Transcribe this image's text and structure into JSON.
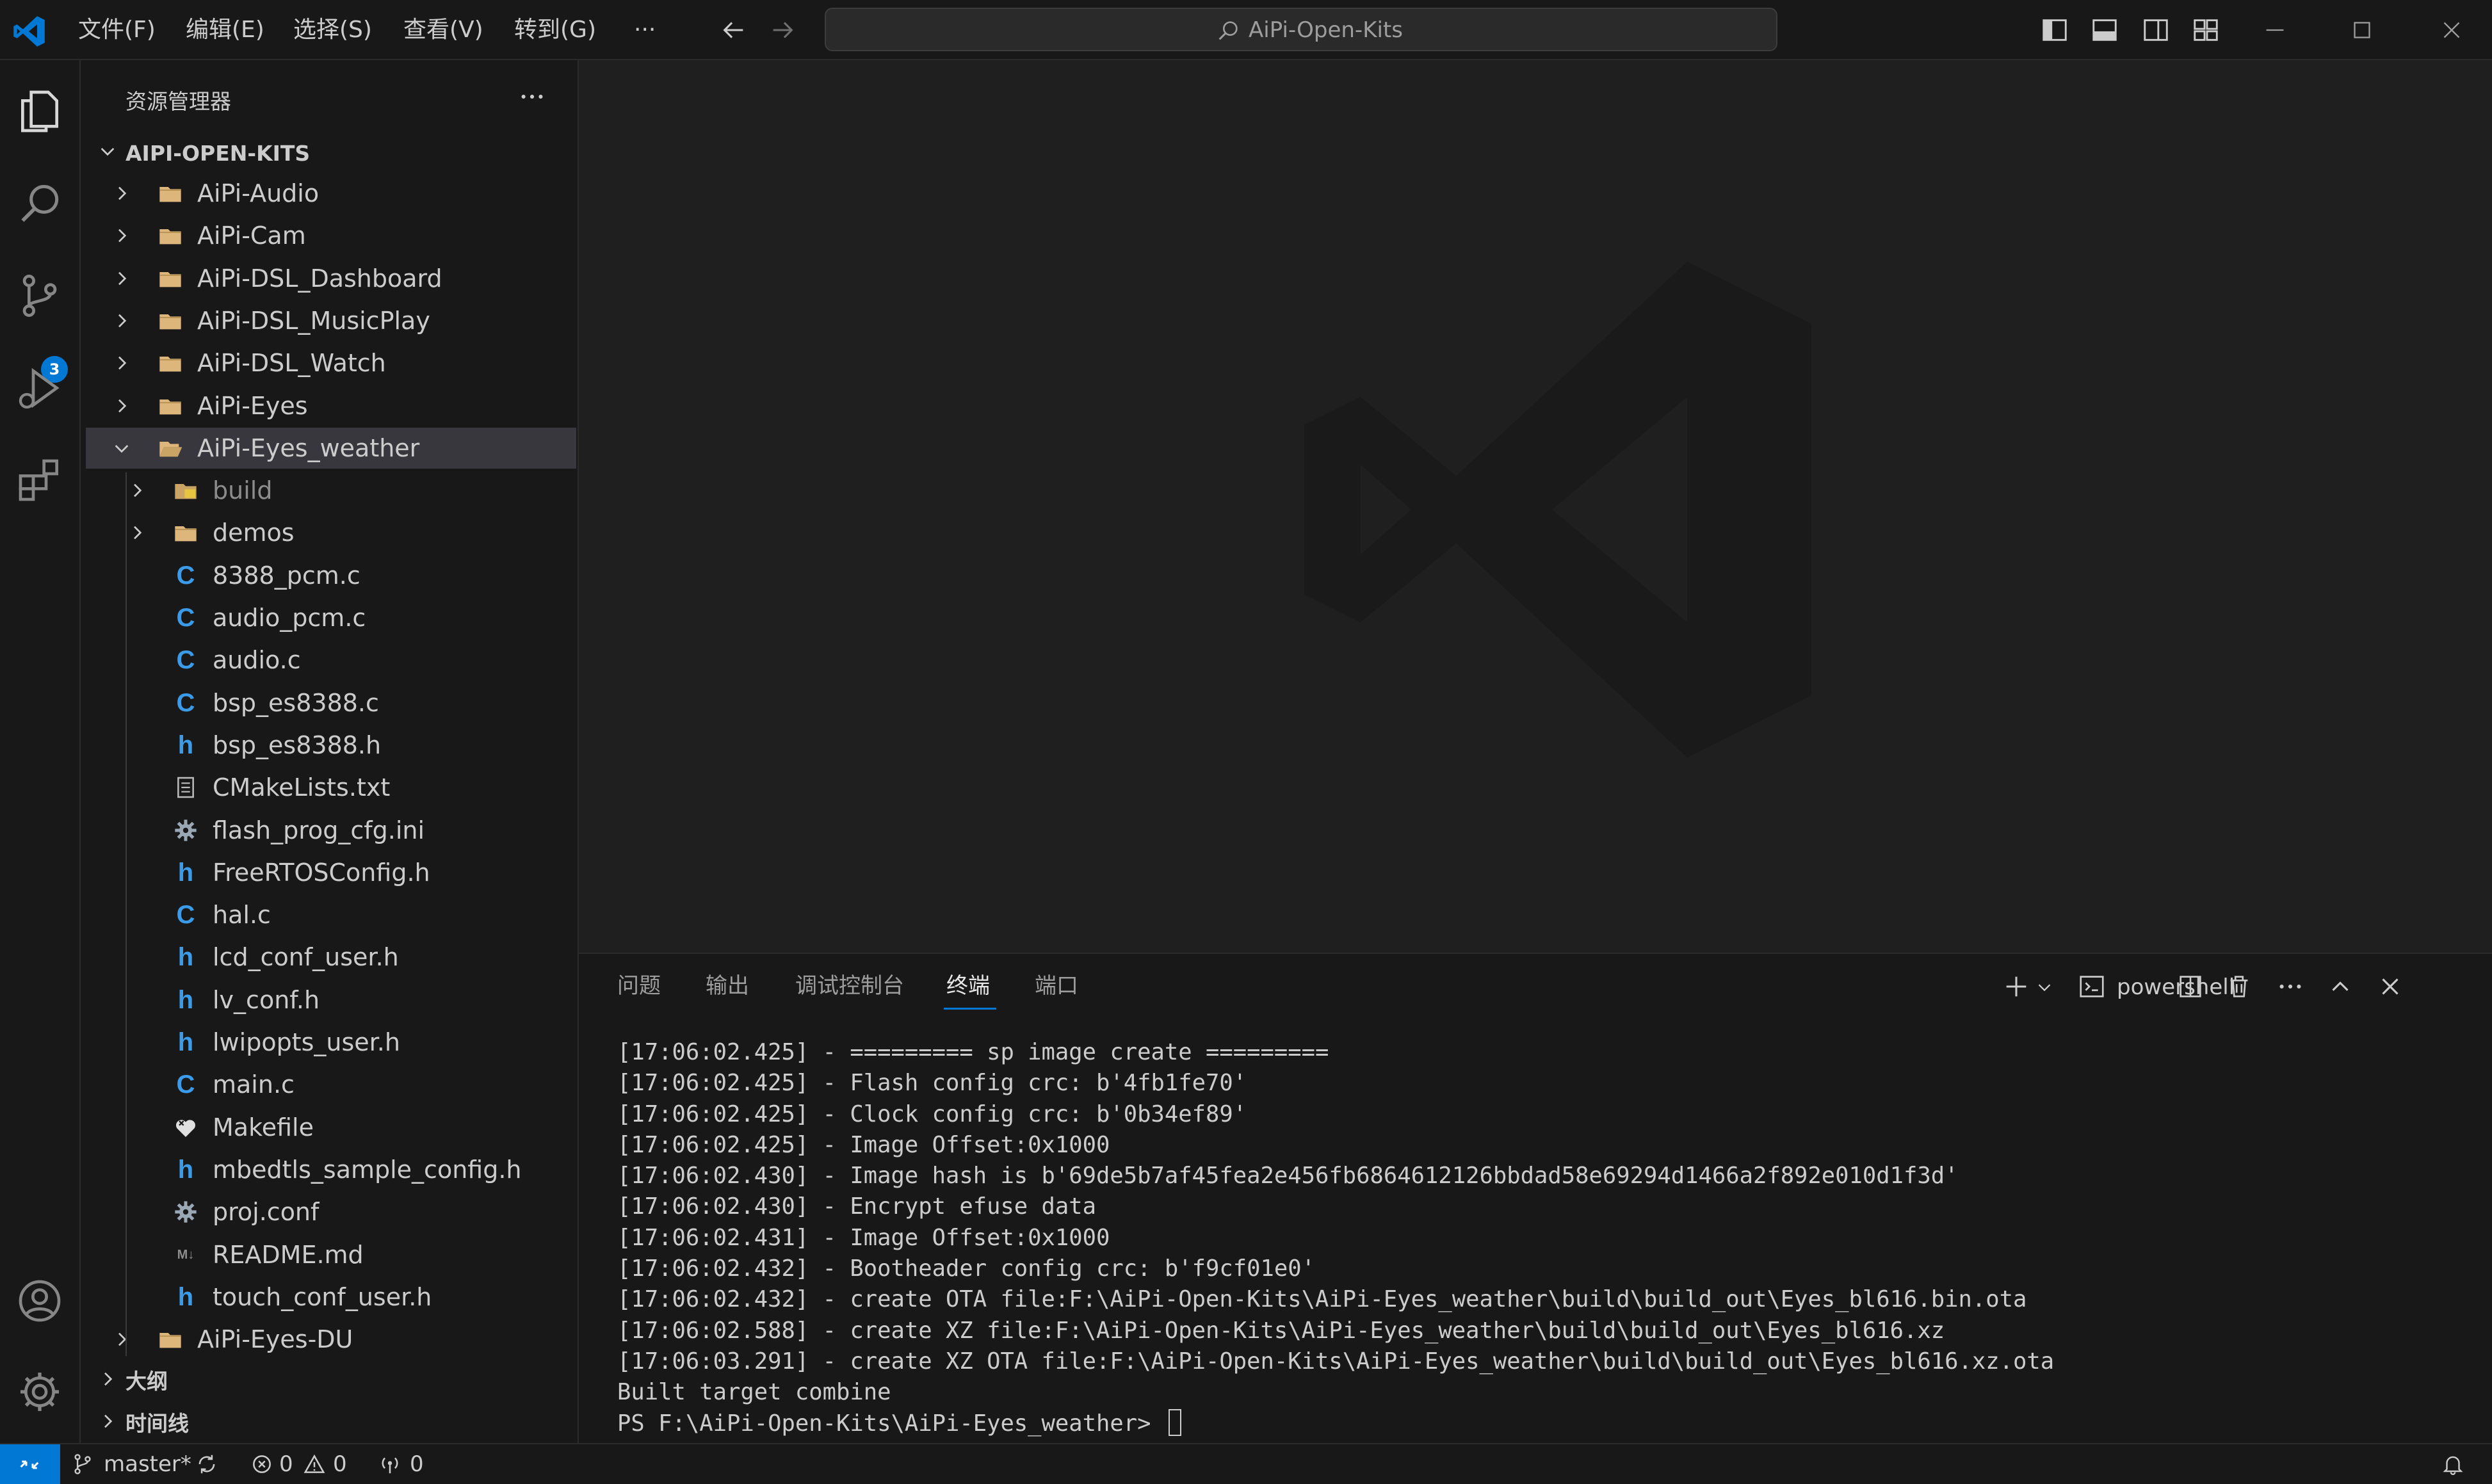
{
  "colors": {
    "accent": "#0078d4",
    "folder": "#dcb67a",
    "c_file": "#3b9be8",
    "background": "#1f1f1f",
    "sidebar": "#181818"
  },
  "titlebar": {
    "menus": [
      "文件(F)",
      "编辑(E)",
      "选择(S)",
      "查看(V)",
      "转到(G)",
      "···"
    ],
    "search_text": "AiPi-Open-Kits",
    "icons": [
      "vscode-logo",
      "arrow-left-icon",
      "arrow-right-icon",
      "search-icon",
      "toggle-sidebar-icon",
      "toggle-panel-icon",
      "toggle-secondary-sidebar-icon",
      "customize-layout-icon",
      "minimize-icon",
      "maximize-icon",
      "close-icon"
    ]
  },
  "activitybar": {
    "items": [
      "explorer-icon",
      "search-icon",
      "source-control-icon",
      "run-debug-icon",
      "extensions-icon"
    ],
    "source_control_badge": "3",
    "bottom": [
      "account-icon",
      "manage-gear-icon"
    ]
  },
  "sidebar": {
    "title": "资源管理器",
    "more": "···",
    "root": "AIPI-OPEN-KITS",
    "tree": [
      {
        "label": "AiPi-Audio",
        "type": "folder",
        "expanded": false,
        "depth": 1
      },
      {
        "label": "AiPi-Cam",
        "type": "folder",
        "expanded": false,
        "depth": 1
      },
      {
        "label": "AiPi-DSL_Dashboard",
        "type": "folder",
        "expanded": false,
        "depth": 1
      },
      {
        "label": "AiPi-DSL_MusicPlay",
        "type": "folder",
        "expanded": false,
        "depth": 1
      },
      {
        "label": "AiPi-DSL_Watch",
        "type": "folder",
        "expanded": false,
        "depth": 1
      },
      {
        "label": "AiPi-Eyes",
        "type": "folder",
        "expanded": false,
        "depth": 1
      },
      {
        "label": "AiPi-Eyes_weather",
        "type": "folder-open",
        "expanded": true,
        "depth": 1,
        "selected": true
      },
      {
        "label": "build",
        "type": "folder-build",
        "expanded": false,
        "depth": 2,
        "dim": true
      },
      {
        "label": "demos",
        "type": "folder",
        "expanded": false,
        "depth": 2
      },
      {
        "label": "8388_pcm.c",
        "type": "c",
        "depth": 2
      },
      {
        "label": "audio_pcm.c",
        "type": "c",
        "depth": 2
      },
      {
        "label": "audio.c",
        "type": "c",
        "depth": 2
      },
      {
        "label": "bsp_es8388.c",
        "type": "c",
        "depth": 2
      },
      {
        "label": "bsp_es8388.h",
        "type": "h",
        "depth": 2
      },
      {
        "label": "CMakeLists.txt",
        "type": "txt",
        "depth": 2
      },
      {
        "label": "flash_prog_cfg.ini",
        "type": "gear",
        "depth": 2
      },
      {
        "label": "FreeRTOSConfig.h",
        "type": "h",
        "depth": 2
      },
      {
        "label": "hal.c",
        "type": "c",
        "depth": 2
      },
      {
        "label": "lcd_conf_user.h",
        "type": "h",
        "depth": 2
      },
      {
        "label": "lv_conf.h",
        "type": "h",
        "depth": 2
      },
      {
        "label": "lwipopts_user.h",
        "type": "h",
        "depth": 2
      },
      {
        "label": "main.c",
        "type": "c",
        "depth": 2
      },
      {
        "label": "Makefile",
        "type": "makefile",
        "depth": 2
      },
      {
        "label": "mbedtls_sample_config.h",
        "type": "h",
        "depth": 2
      },
      {
        "label": "proj.conf",
        "type": "gear",
        "depth": 2
      },
      {
        "label": "README.md",
        "type": "md",
        "depth": 2
      },
      {
        "label": "touch_conf_user.h",
        "type": "h",
        "depth": 2
      },
      {
        "label": "AiPi-Eyes-DU",
        "type": "folder",
        "expanded": false,
        "depth": 1
      }
    ],
    "sections": [
      "大纲",
      "时间线"
    ],
    "file_icon_glyphs": {
      "c": "C",
      "h": "h",
      "md": "M↓"
    }
  },
  "panel": {
    "tabs": [
      "问题",
      "输出",
      "调试控制台",
      "终端",
      "端口"
    ],
    "active_tab": "终端",
    "shell": "powershell",
    "terminal_lines": [
      "[17:06:02.425] - ========= sp image create =========",
      "[17:06:02.425] - Flash config crc: b'4fb1fe70'",
      "[17:06:02.425] - Clock config crc: b'0b34ef89'",
      "[17:06:02.425] - Image Offset:0x1000",
      "[17:06:02.430] - Image hash is b'69de5b7af45fea2e456fb6864612126bbdad58e69294d1466a2f892e010d1f3d'",
      "[17:06:02.430] - Encrypt efuse data",
      "[17:06:02.431] - Image Offset:0x1000",
      "[17:06:02.432] - Bootheader config crc: b'f9cf01e0'",
      "[17:06:02.432] - create OTA file:F:\\AiPi-Open-Kits\\AiPi-Eyes_weather\\build\\build_out\\Eyes_bl616.bin.ota",
      "[17:06:02.588] - create XZ file:F:\\AiPi-Open-Kits\\AiPi-Eyes_weather\\build\\build_out\\Eyes_bl616.xz",
      "[17:06:03.291] - create XZ OTA file:F:\\AiPi-Open-Kits\\AiPi-Eyes_weather\\build\\build_out\\Eyes_bl616.xz.ota",
      "Built target combine",
      "PS F:\\AiPi-Open-Kits\\AiPi-Eyes_weather> "
    ]
  },
  "statusbar": {
    "branch": "master*",
    "errors": "0",
    "warnings": "0",
    "ports": "0"
  }
}
